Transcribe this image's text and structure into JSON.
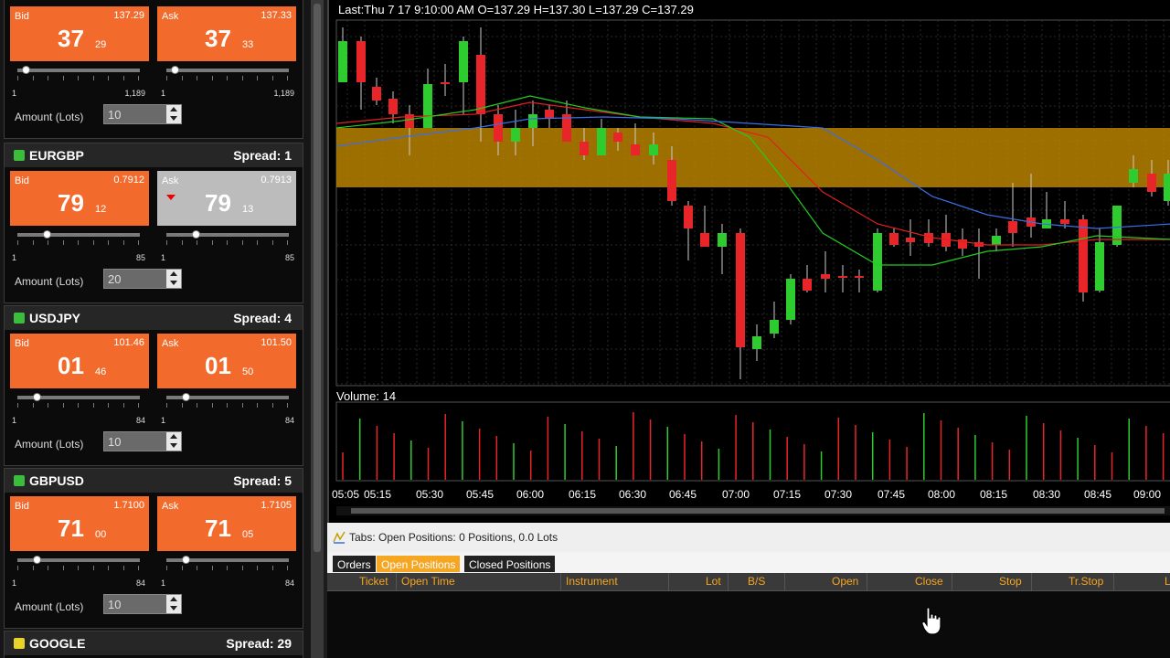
{
  "panels": [
    {
      "symbol": "",
      "spread_label": "",
      "bid": {
        "label": "Bid",
        "full": "137.29",
        "big": "37",
        "small": "29"
      },
      "ask": {
        "label": "Ask",
        "full": "137.33",
        "big": "37",
        "small": "33",
        "highlight": false
      },
      "bid_range": {
        "min": "1",
        "max": "1,189"
      },
      "ask_range": {
        "min": "1",
        "max": "1,189"
      },
      "amount_label": "Amount (Lots)",
      "amount_value": "10"
    },
    {
      "symbol": "EURGBP",
      "spread_label": "Spread: 1",
      "bid": {
        "label": "Bid",
        "full": "0.7912",
        "big": "79",
        "small": "12"
      },
      "ask": {
        "label": "Ask",
        "full": "0.7913",
        "big": "79",
        "small": "13",
        "highlight": true
      },
      "bid_range": {
        "min": "1",
        "max": "85"
      },
      "ask_range": {
        "min": "1",
        "max": "85"
      },
      "amount_label": "Amount (Lots)",
      "amount_value": "20"
    },
    {
      "symbol": "USDJPY",
      "spread_label": "Spread: 4",
      "bid": {
        "label": "Bid",
        "full": "101.46",
        "big": "01",
        "small": "46"
      },
      "ask": {
        "label": "Ask",
        "full": "101.50",
        "big": "01",
        "small": "50",
        "highlight": false
      },
      "bid_range": {
        "min": "1",
        "max": "84"
      },
      "ask_range": {
        "min": "1",
        "max": "84"
      },
      "amount_label": "Amount (Lots)",
      "amount_value": "10"
    },
    {
      "symbol": "GBPUSD",
      "spread_label": "Spread: 5",
      "bid": {
        "label": "Bid",
        "full": "1.7100",
        "big": "71",
        "small": "00"
      },
      "ask": {
        "label": "Ask",
        "full": "1.7105",
        "big": "71",
        "small": "05",
        "highlight": false
      },
      "bid_range": {
        "min": "1",
        "max": "84"
      },
      "ask_range": {
        "min": "1",
        "max": "84"
      },
      "amount_label": "Amount (Lots)",
      "amount_value": "10"
    },
    {
      "symbol": "GOOGLE",
      "spread_label": "Spread: 29"
    }
  ],
  "chart": {
    "ohlc_label": "Last:Thu 7 17 9:10:00 AM O=137.29 H=137.30 L=137.29 C=137.29",
    "volume_label": "Volume: 14",
    "time_labels": [
      "05:05",
      "05:15",
      "05:30",
      "05:45",
      "06:00",
      "06:15",
      "06:30",
      "06:45",
      "07:00",
      "07:15",
      "07:30",
      "07:45",
      "08:00",
      "08:15",
      "08:30",
      "08:45",
      "09:00"
    ],
    "colors": {
      "up": "#2ecc2e",
      "down": "#e8262a",
      "ma_red": "#e02020",
      "ma_green": "#22cc22",
      "ma_blue": "#3a6ee8",
      "band": "#b98200"
    }
  },
  "bottom": {
    "title": "Tabs: Open Positions: 0 Positions, 0.0 Lots",
    "tabs": [
      "Orders",
      "Open Positions",
      "Closed Positions"
    ],
    "active_tab": "Open Positions",
    "columns": [
      "Ticket",
      "Open Time",
      "Instrument",
      "Lot",
      "B/S",
      "Open",
      "Close",
      "Stop",
      "Tr.Stop",
      "L"
    ]
  }
}
